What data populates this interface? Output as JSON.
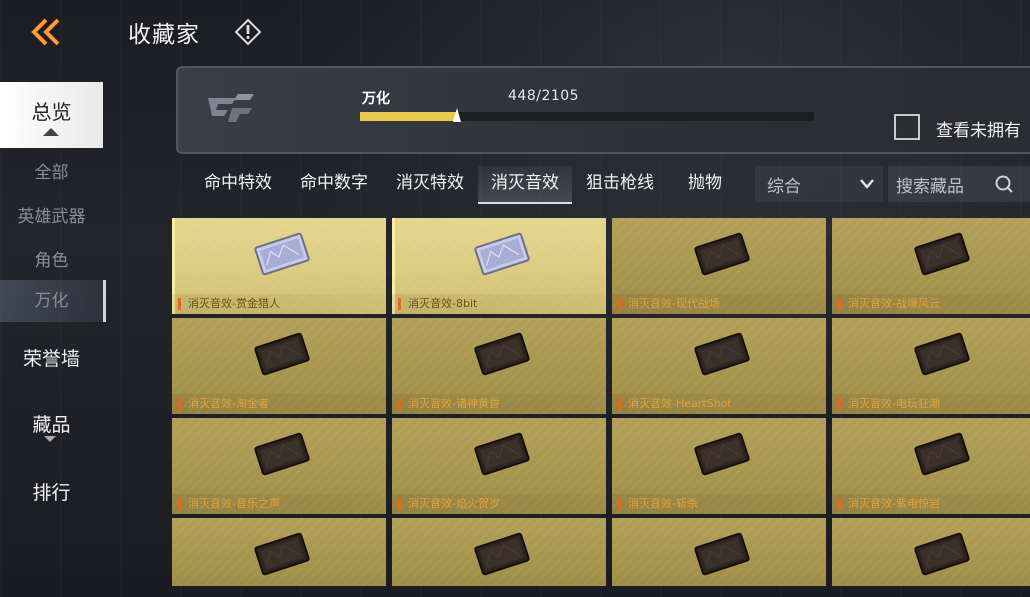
{
  "header": {
    "title": "收藏家",
    "back_icon": "double-chevron-left-icon",
    "info_icon": "exclamation-diamond-icon"
  },
  "sidebar": {
    "items": [
      {
        "label": "总览",
        "selected": true
      },
      {
        "label": "全部"
      },
      {
        "label": "英雄武器"
      },
      {
        "label": "角色"
      },
      {
        "label": "万化",
        "selected": true
      },
      {
        "label": "荣誉墙"
      },
      {
        "label": "藏品"
      },
      {
        "label": "排行"
      }
    ]
  },
  "progress": {
    "label": "万化",
    "count": "448/2105",
    "current": 448,
    "total": 2105,
    "fill_color": "#e9c850"
  },
  "filter": {
    "show_unowned_label": "查看未拥有",
    "show_unowned_checked": false
  },
  "tabs": [
    {
      "label": "命中特效"
    },
    {
      "label": "命中数字"
    },
    {
      "label": "消灭特效"
    },
    {
      "label": "消灭音效",
      "active": true
    },
    {
      "label": "狙击枪线"
    },
    {
      "label": "抛物"
    }
  ],
  "sort": {
    "label": "综合"
  },
  "search": {
    "placeholder": "搜索藏品"
  },
  "items": [
    {
      "name": "消灭音效-赏金猎人",
      "owned": true
    },
    {
      "name": "消灭音效-8bit",
      "owned": true
    },
    {
      "name": "消灭音效-现代战场",
      "owned": false
    },
    {
      "name": "消灭音效-战壕风云",
      "owned": false
    },
    {
      "name": "消灭音效-淘金者",
      "owned": false
    },
    {
      "name": "消灭音效-诸神黄昏",
      "owned": false
    },
    {
      "name": "消灭音效-HeartShot",
      "owned": false
    },
    {
      "name": "消灭音效-电玩狂潮",
      "owned": false
    },
    {
      "name": "消灭音效-音乐之声",
      "owned": false
    },
    {
      "name": "消灭音效-焰火贺岁",
      "owned": false
    },
    {
      "name": "消灭音效-斩杀",
      "owned": false
    },
    {
      "name": "消灭音效-紫电惊岩",
      "owned": false
    },
    {
      "name": "",
      "owned": false
    },
    {
      "name": "",
      "owned": false
    },
    {
      "name": "",
      "owned": false
    },
    {
      "name": "",
      "owned": false
    }
  ]
}
